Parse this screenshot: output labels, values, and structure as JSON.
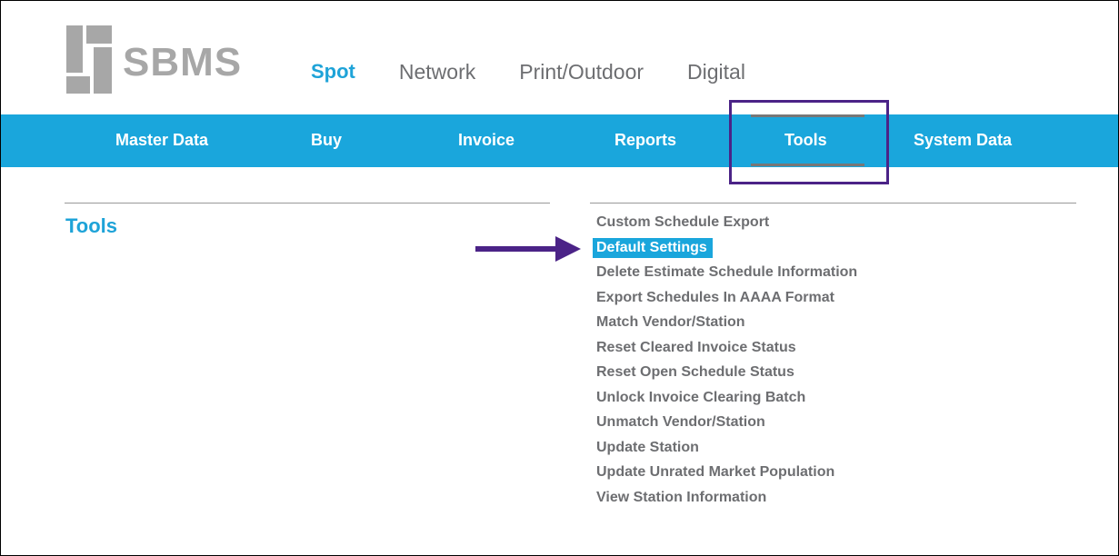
{
  "logo": {
    "text": "SBMS"
  },
  "top_tabs": [
    {
      "label": "Spot",
      "active": true
    },
    {
      "label": "Network",
      "active": false
    },
    {
      "label": "Print/Outdoor",
      "active": false
    },
    {
      "label": "Digital",
      "active": false
    }
  ],
  "nav": [
    {
      "label": "Master Data"
    },
    {
      "label": "Buy"
    },
    {
      "label": "Invoice"
    },
    {
      "label": "Reports"
    },
    {
      "label": "Tools",
      "active": true
    },
    {
      "label": "System Data"
    }
  ],
  "section": {
    "title": "Tools"
  },
  "tools": [
    {
      "label": "Custom Schedule Export"
    },
    {
      "label": "Default Settings",
      "selected": true
    },
    {
      "label": "Delete Estimate Schedule Information"
    },
    {
      "label": "Export Schedules In AAAA Format"
    },
    {
      "label": "Match Vendor/Station"
    },
    {
      "label": "Reset Cleared Invoice Status"
    },
    {
      "label": "Reset Open Schedule Status"
    },
    {
      "label": "Unlock Invoice Clearing Batch"
    },
    {
      "label": "Unmatch Vendor/Station"
    },
    {
      "label": "Update Station"
    },
    {
      "label": "Update Unrated Market Population"
    },
    {
      "label": "View Station Information"
    }
  ],
  "colors": {
    "accent": "#1aa6dc",
    "annotation": "#4b2387",
    "text_gray": "#6d6e71"
  }
}
